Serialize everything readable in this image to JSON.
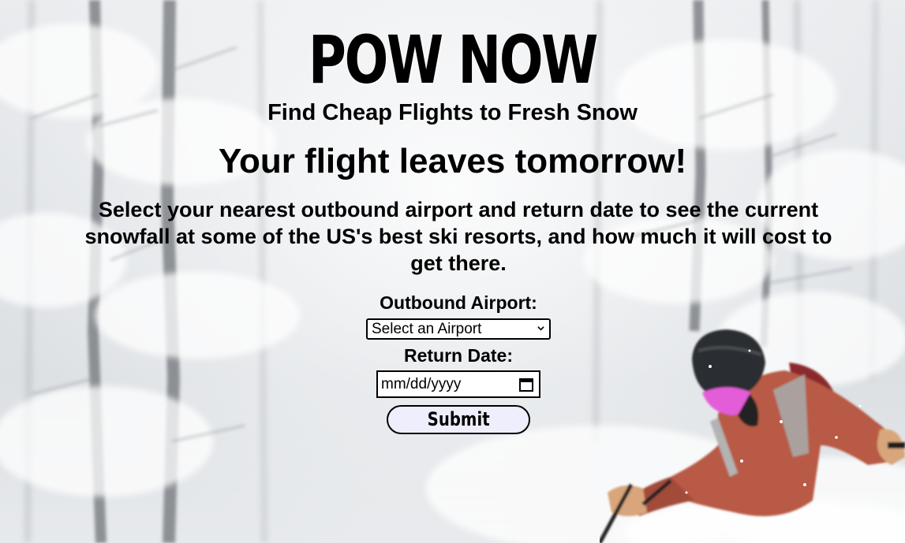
{
  "header": {
    "logo": "POW NOW",
    "tagline": "Find Cheap Flights to Fresh Snow"
  },
  "main": {
    "headline": "Your flight leaves tomorrow!",
    "intro": "Select your nearest outbound airport and return date to see the current snowfall at some of the US's best ski resorts, and how much it will cost to get there."
  },
  "form": {
    "airport_label": "Outbound Airport:",
    "airport_selected": "Select an Airport",
    "return_label": "Return Date:",
    "return_placeholder": "mm/dd/yyyy",
    "submit_label": "Submit"
  },
  "colors": {
    "text": "#000000",
    "submit_bg": "#eeeefc",
    "jacket": "#b85a45",
    "goggles": "#e35bd8"
  },
  "icons": {
    "select_arrow": "chevron-down-icon",
    "date_picker": "calendar-icon"
  }
}
